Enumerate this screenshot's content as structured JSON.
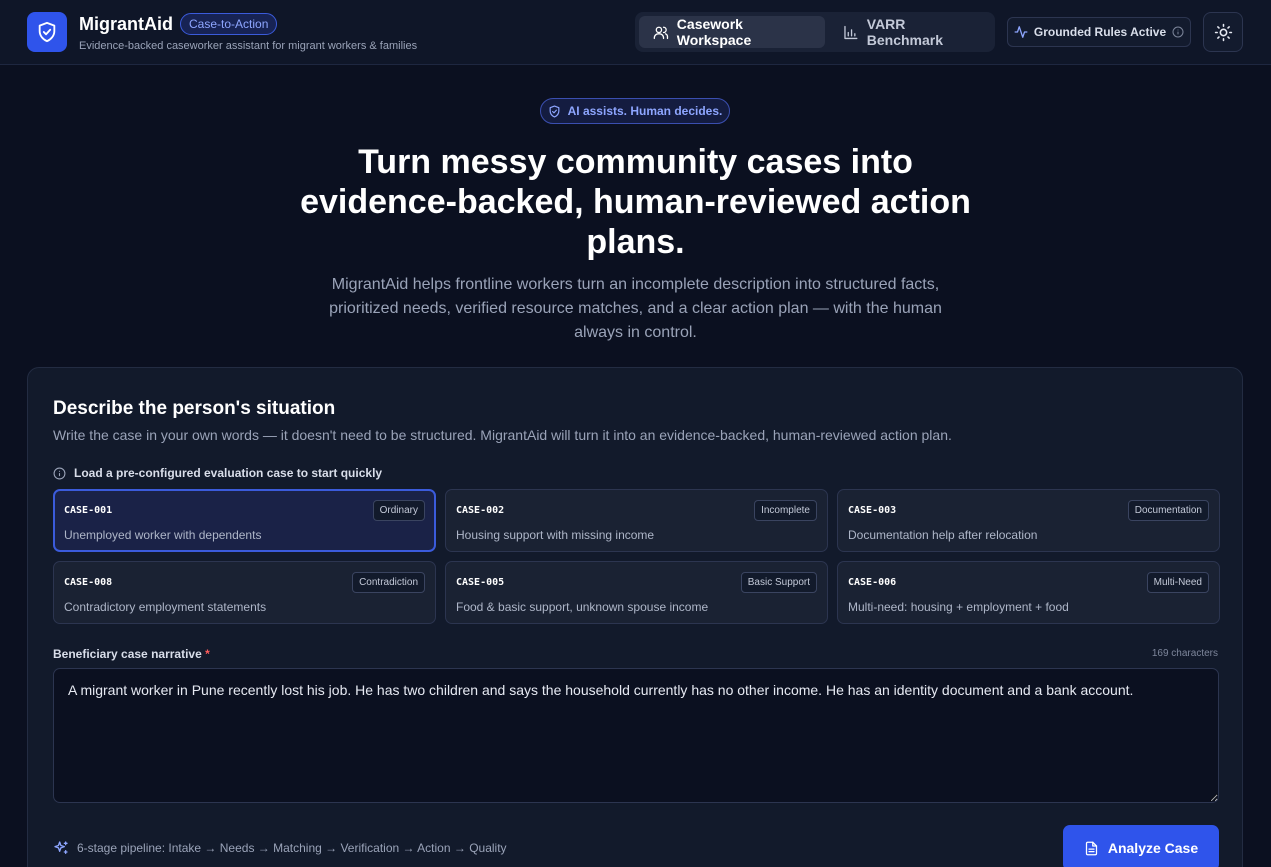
{
  "header": {
    "app_name": "MigrantAid",
    "badge": "Case-to-Action",
    "subtitle": "Evidence-backed caseworker assistant for migrant workers & families",
    "tabs": [
      {
        "label": "Casework Workspace",
        "icon": "users-icon",
        "active": true
      },
      {
        "label": "VARR Benchmark",
        "icon": "bar-chart-icon",
        "active": false
      }
    ],
    "status": "Grounded Rules Active",
    "theme_icon": "sun-icon"
  },
  "hero": {
    "pill": "AI assists. Human decides.",
    "title": "Turn messy community cases into evidence-backed, human-reviewed action plans.",
    "subtitle": "MigrantAid helps frontline workers turn an incomplete description into structured facts, prioritized needs, verified resource matches, and a clear action plan — with the human always in control."
  },
  "form": {
    "title": "Describe the person's situation",
    "subtitle": "Write the case in your own words — it doesn't need to be structured. MigrantAid will turn it into an evidence-backed, human-reviewed action plan.",
    "load_label": "Load a pre-configured evaluation case to start quickly",
    "cases": [
      {
        "id": "CASE-001",
        "tag": "Ordinary",
        "desc": "Unemployed worker with dependents",
        "selected": true
      },
      {
        "id": "CASE-002",
        "tag": "Incomplete",
        "desc": "Housing support with missing income",
        "selected": false
      },
      {
        "id": "CASE-003",
        "tag": "Documentation",
        "desc": "Documentation help after relocation",
        "selected": false
      },
      {
        "id": "CASE-008",
        "tag": "Contradiction",
        "desc": "Contradictory employment statements",
        "selected": false
      },
      {
        "id": "CASE-005",
        "tag": "Basic Support",
        "desc": "Food & basic support, unknown spouse income",
        "selected": false
      },
      {
        "id": "CASE-006",
        "tag": "Multi-Need",
        "desc": "Multi-need: housing + employment + food",
        "selected": false
      }
    ],
    "narrative_label": "Beneficiary case narrative",
    "required_mark": "*",
    "char_count": "169 characters",
    "narrative_value": "A migrant worker in Pune recently lost his job. He has two children and says the household currently has no other income. He has an identity document and a bank account.",
    "pipeline": "6-stage pipeline: Intake → Needs → Matching → Verification → Action → Quality",
    "analyze_label": "Analyze Case"
  },
  "colors": {
    "background": "#0b1020",
    "accent": "#2f54eb",
    "accent_text": "#8ea6ff",
    "required": "#ff5c5c"
  }
}
